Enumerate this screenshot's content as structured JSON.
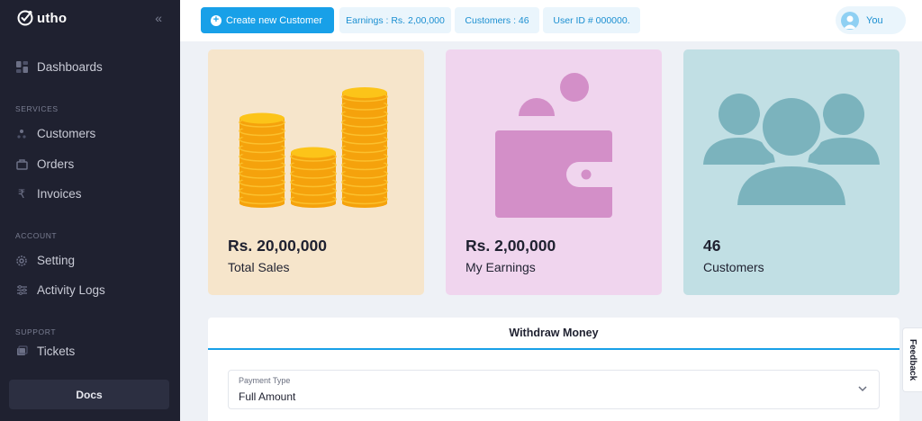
{
  "brand": {
    "name": "utho"
  },
  "sidebar": {
    "items_top": [
      {
        "label": "Dashboards",
        "icon": "dashboard-icon"
      }
    ],
    "sections": [
      {
        "title": "SERVICES",
        "items": [
          {
            "label": "Customers",
            "icon": "customers-icon"
          },
          {
            "label": "Orders",
            "icon": "orders-icon"
          },
          {
            "label": "Invoices",
            "icon": "rupee-icon"
          }
        ]
      },
      {
        "title": "ACCOUNT",
        "items": [
          {
            "label": "Setting",
            "icon": "gear-icon"
          },
          {
            "label": "Activity Logs",
            "icon": "sliders-icon"
          }
        ]
      },
      {
        "title": "SUPPORT",
        "items": [
          {
            "label": "Tickets",
            "icon": "ticket-icon"
          }
        ]
      }
    ],
    "docs_label": "Docs"
  },
  "topbar": {
    "create_label": "Create new Customer",
    "earnings_chip": "Earnings : Rs. 2,00,000",
    "customers_chip": "Customers : 46",
    "userid_chip": "User ID # 000000.",
    "user_label": "You"
  },
  "cards": [
    {
      "value": "Rs. 20,00,000",
      "label": "Total Sales",
      "bg": "#f6e5cb",
      "icon": "coins-icon"
    },
    {
      "value": "Rs. 2,00,000",
      "label": "My Earnings",
      "bg": "#f0d5ee",
      "icon": "wallet-icon"
    },
    {
      "value": "46",
      "label": "Customers",
      "bg": "#c1dfe4",
      "icon": "people-icon"
    }
  ],
  "withdraw": {
    "title": "Withdraw Money",
    "payment_type_label": "Payment Type",
    "payment_type_value": "Full Amount"
  },
  "feedback_label": "Feedback",
  "colors": {
    "accent": "#18a0e8",
    "sidebar_bg": "#1f2130",
    "page_bg": "#eef1f6"
  }
}
